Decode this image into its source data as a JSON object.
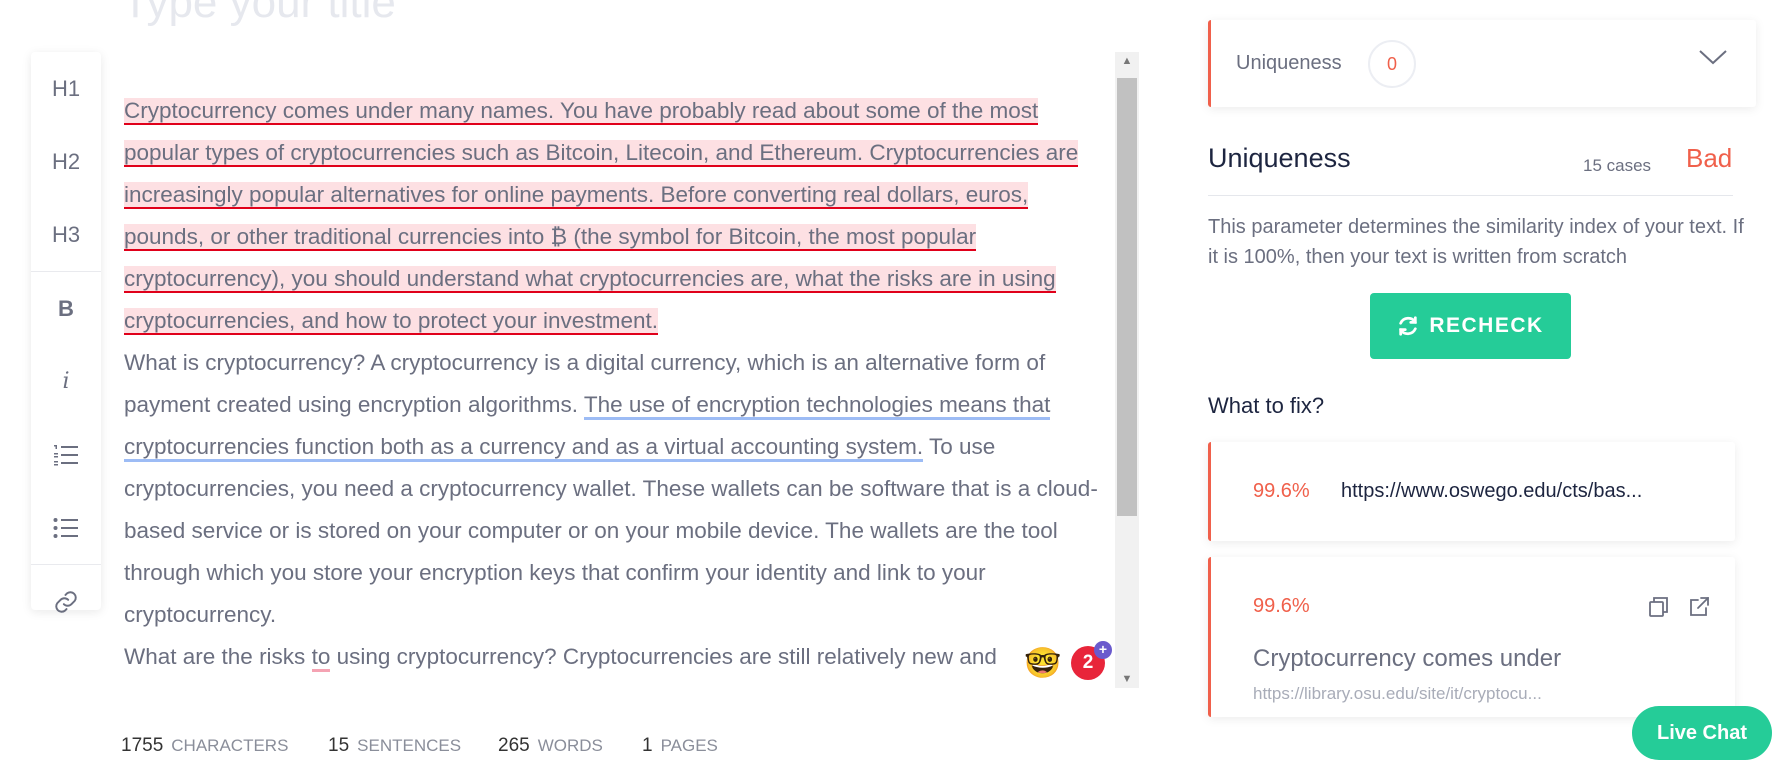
{
  "editor": {
    "title_placeholder": "Type your title",
    "para1_highlighted": " Cryptocurrency comes under many names. You have probably read about some of the most popular types of cryptocurrencies such as Bitcoin, Litecoin, and Ethereum. Cryptocurrencies are increasingly popular alternatives for online payments. Before converting real dollars, euros, pounds, or other traditional currencies into ₿ (the symbol for Bitcoin, the most popular cryptocurrency), you should understand what cryptocurrencies are, what the risks are in using cryptocurrencies, and how to protect your investment. ",
    "para2_a": " What is cryptocurrency? A cryptocurrency is a digital currency, which is an alternative form of payment created using encryption algorithms. ",
    "para2_underlined": "The use of encryption technologies means that cryptocurrencies function both as a currency and as a virtual accounting system.",
    "para2_b": " To use cryptocurrencies, you need a cryptocurrency wallet. These wallets can be software that is a cloud-based service or is stored on your computer or on your mobile device. The wallets are the tool through which you store your encryption keys that confirm your identity and link to your cryptocurrency.",
    "para3_a": " What are the risks ",
    "para3_underlined": "to",
    "para3_b": " using cryptocurrency? Cryptocurrencies are still relatively new and",
    "notification_count": "2"
  },
  "toolbar": {
    "h1": "H1",
    "h2": "H2",
    "h3": "H3",
    "bold": "B",
    "italic": "i"
  },
  "stats": {
    "characters_num": "1755",
    "characters_label": "CHARACTERS",
    "sentences_num": "15",
    "sentences_label": "SENTENCES",
    "words_num": "265",
    "words_label": "WORDS",
    "pages_num": "1",
    "pages_label": "PAGES"
  },
  "panel": {
    "card_label": "Uniqueness",
    "card_score": "0",
    "heading": "Uniqueness",
    "cases": "15 cases",
    "status": "Bad",
    "description": "This parameter determines the similarity index of your text. If it is 100%, then your text is written from scratch",
    "recheck_label": "RECHECK",
    "fix_heading": "What to fix?",
    "sources": [
      {
        "percent": "99.6%",
        "url": "https://www.oswego.edu/cts/bas..."
      },
      {
        "percent": "99.6%",
        "title": "Cryptocurrency comes under",
        "url": "https://library.osu.edu/site/it/cryptocu..."
      }
    ]
  },
  "live_chat": "Live Chat",
  "colors": {
    "accent_green": "#25cc98",
    "status_red": "#f0604b",
    "highlight_red": "#e0001a",
    "underline_blue": "#9dbcf5"
  }
}
